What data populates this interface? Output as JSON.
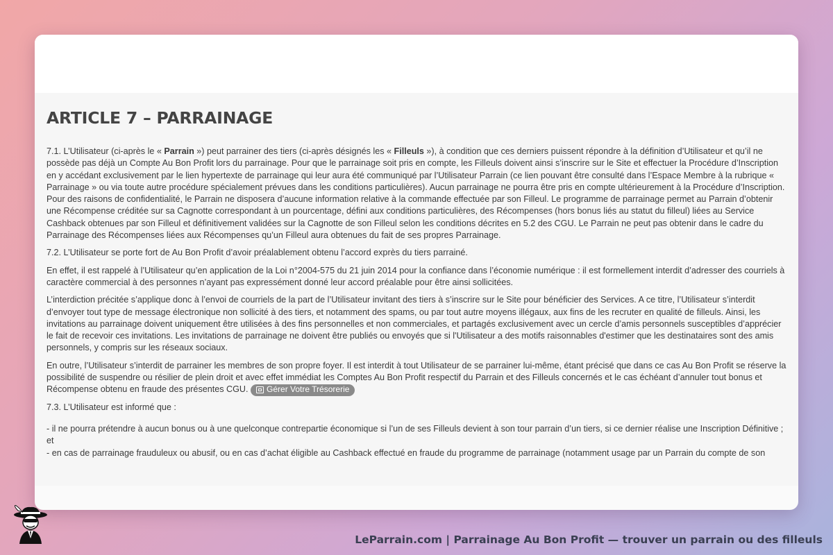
{
  "article": {
    "title": "ARTICLE 7 – PARRAINAGE",
    "p1": {
      "a": "7.1. L’Utilisateur (ci-après le « ",
      "b": "Parrain",
      "c": " ») peut parrainer des tiers (ci-après désignés les « ",
      "d": "Filleuls",
      "e": " »), à condition que ces derniers puissent répondre à la définition d’Utilisateur et qu’il ne possède pas déjà un Compte Au Bon Profit lors du parrainage. Pour que le parrainage soit pris en compte, les Filleuls doivent ainsi s’inscrire sur le Site et effectuer la Procédure d’Inscription en y accédant exclusivement par le lien hypertexte de parrainage qui leur aura été communiqué par l’Utilisateur Parrain (ce lien pouvant être consulté dans l’Espace Membre à la rubrique « Parrainage » ou via toute autre procédure spécialement prévues dans les conditions particulières). Aucun parrainage ne pourra être pris en compte ultérieurement à la Procédure d’Inscription. Pour des raisons de confidentialité, le Parrain ne disposera d’aucune information relative à la commande effectuée par son Filleul. Le programme de parrainage permet au Parrain d’obtenir une Récompense créditée sur sa Cagnotte correspondant à un pourcentage, défini aux conditions particulières, des Récompenses (hors bonus liés au statut du filleul) liées au Service Cashback obtenues par son Filleul et définitivement validées sur la Cagnotte de son Filleul selon les conditions décrites en 5.2 des CGU. Le Parrain ne peut pas obtenir dans le cadre du Parrainage des Récompenses liées aux Récompenses qu’un Filleul aura obtenues du fait de ses propres Parrainage."
    },
    "p2": "7.2. L’Utilisateur se porte fort de Au Bon Profit d’avoir préalablement obtenu l’accord exprès du tiers parrainé.",
    "p3": "En effet, il est rappelé à l’Utilisateur qu’en application de la Loi n°2004-575 du 21 juin 2014 pour la confiance dans l’économie numérique : il est formellement interdit d’adresser des courriels à caractère commercial à des personnes n’ayant pas expressément donné leur accord préalable pour être ainsi sollicitées.",
    "p4": "L’interdiction précitée s’applique donc à l’envoi de courriels de la part de l’Utilisateur invitant des tiers à s’inscrire sur le Site pour bénéficier des Services. A ce titre, l’Utilisateur s’interdit d’envoyer tout type de message électronique non sollicité à des tiers, et notamment des spams, ou par tout autre moyens illégaux, aux fins de les recruter en qualité de filleuls. Ainsi, les invitations au parrainage doivent uniquement être utilisées à des fins personnelles et non commerciales, et partagés exclusivement avec un cercle d’amis personnels susceptibles d’apprécier le fait de recevoir ces invitations. Les invitations de parrainage ne doivent être publiés ou envoyés que si l'Utilisateur a des motifs raisonnables d'estimer que les destinataires sont des amis personnels, y compris sur les réseaux sociaux.",
    "p5": "En outre, l’Utilisateur s’interdit de parrainer les membres de son propre foyer. Il est interdit à tout Utilisateur de se parrainer lui-même, étant précisé que dans ce cas Au Bon Profit se réserve la possibilité de suspendre ou résilier de plein droit et avec effet immédiat les Comptes Au Bon Profit respectif du Parrain et des Filleuls concernés et le cas échéant d’annuler tout bonus et Récompense obtenu en fraude des présentes CGU.",
    "p5_tag": "Gérer Votre Trésorerie",
    "p6": "7.3. L’Utilisateur est informé que :",
    "p7a": "- il ne pourra prétendre à aucun bonus ou à une quelconque contrepartie économique si l’un de ses Filleuls devient à son tour parrain d’un tiers, si ce dernier réalise une Inscription Définitive ; et",
    "p7b": "- en cas de parrainage frauduleux ou abusif, ou en cas d’achat éligible au Cashback effectué en fraude du programme de parrainage (notamment usage par un Parrain du compte de son"
  },
  "footer": {
    "text": "LeParrain.com | Parrainage Au Bon Profit — trouver un parrain ou des filleuls"
  },
  "icons": {
    "tag_icon": "wallet-icon",
    "logo": "parrain-mascot-logo"
  }
}
